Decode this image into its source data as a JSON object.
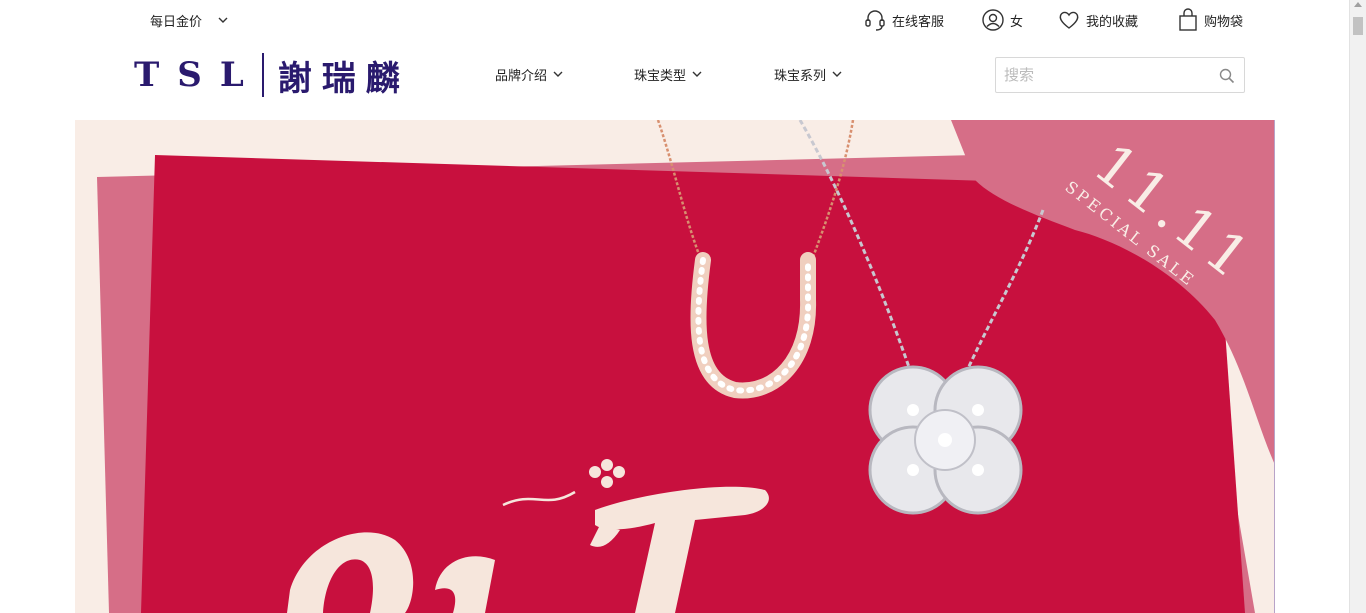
{
  "topbar": {
    "gold_price_label": "每日金价",
    "service_label": "在线客服",
    "account_label": "女",
    "favorites_label": "我的收藏",
    "bag_label": "购物袋"
  },
  "header": {
    "logo_en": "TSL",
    "logo_cn": "謝瑞麟",
    "nav": [
      {
        "label": "品牌介绍"
      },
      {
        "label": "珠宝类型"
      },
      {
        "label": "珠宝系列"
      }
    ],
    "search_placeholder": "搜索"
  },
  "banner": {
    "sale_date": "11.11",
    "sale_text": "SPECIAL SALE",
    "colors": {
      "background": "#f9ede6",
      "crimson": "#c8103e",
      "pink": "#d66e87",
      "cream_text": "#f6e6dc"
    }
  },
  "icons": {
    "dropdown": "chevron-down-icon",
    "service": "headset-icon",
    "account": "user-icon",
    "favorites": "heart-icon",
    "bag": "bag-icon",
    "search": "search-icon"
  }
}
